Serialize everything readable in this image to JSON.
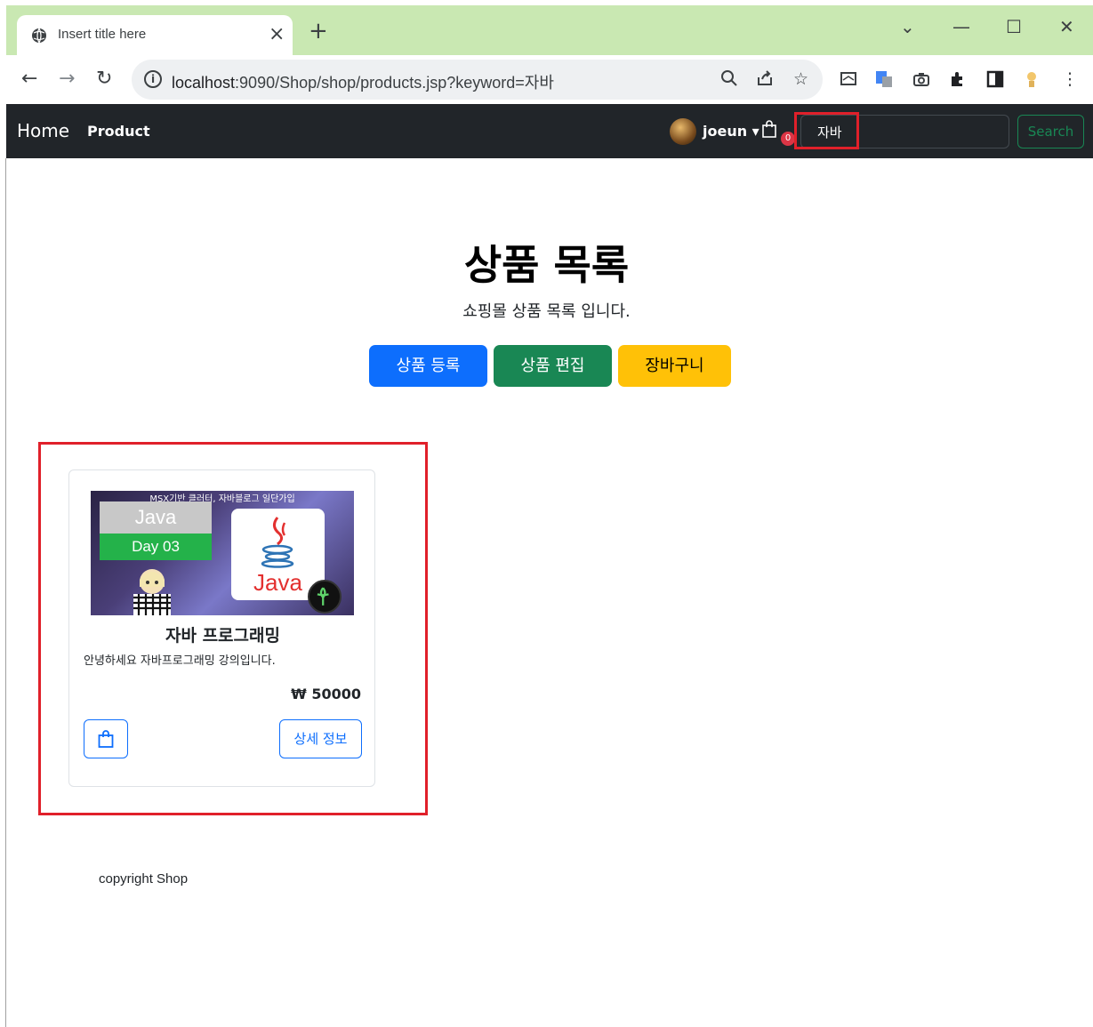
{
  "browser": {
    "tab_title": "Insert title here",
    "tab_close": "×",
    "new_tab": "+",
    "url_host": "localhost",
    "url_rest": ":9090/Shop/shop/products.jsp?keyword=자바",
    "window_controls": {
      "dropdown": "⌄",
      "minimize": "—",
      "maximize": "☐",
      "close": "✕"
    }
  },
  "navbar": {
    "brand": "Home",
    "link_product": "Product",
    "user_name": "joeun ▾",
    "cart_count": "0",
    "search_value": "자바",
    "search_button": "Search"
  },
  "header": {
    "title": "상품 목록",
    "subtitle": "쇼핑몰 상품 목록 입니다."
  },
  "actions": {
    "register": "상품 등록",
    "edit": "상품 편집",
    "cart": "장바구니"
  },
  "products": [
    {
      "thumb_caption": "MSX기반 클러터, 자바블로그 일단가입",
      "thumb_java": "Java",
      "thumb_day": "Day 03",
      "thumb_logo_text": "Java",
      "name": "자바 프로그래밍",
      "description": "안녕하세요 자바프로그래밍 강의입니다.",
      "price": "₩ 50000",
      "detail_label": "상세 정보"
    }
  ],
  "footer": {
    "text": "copyright Shop"
  },
  "colors": {
    "navbar_bg": "#212529",
    "primary": "#0d6efd",
    "success": "#198754",
    "warning": "#ffc107",
    "highlight": "#e0202a",
    "tab_strip": "#c9e8b2"
  }
}
